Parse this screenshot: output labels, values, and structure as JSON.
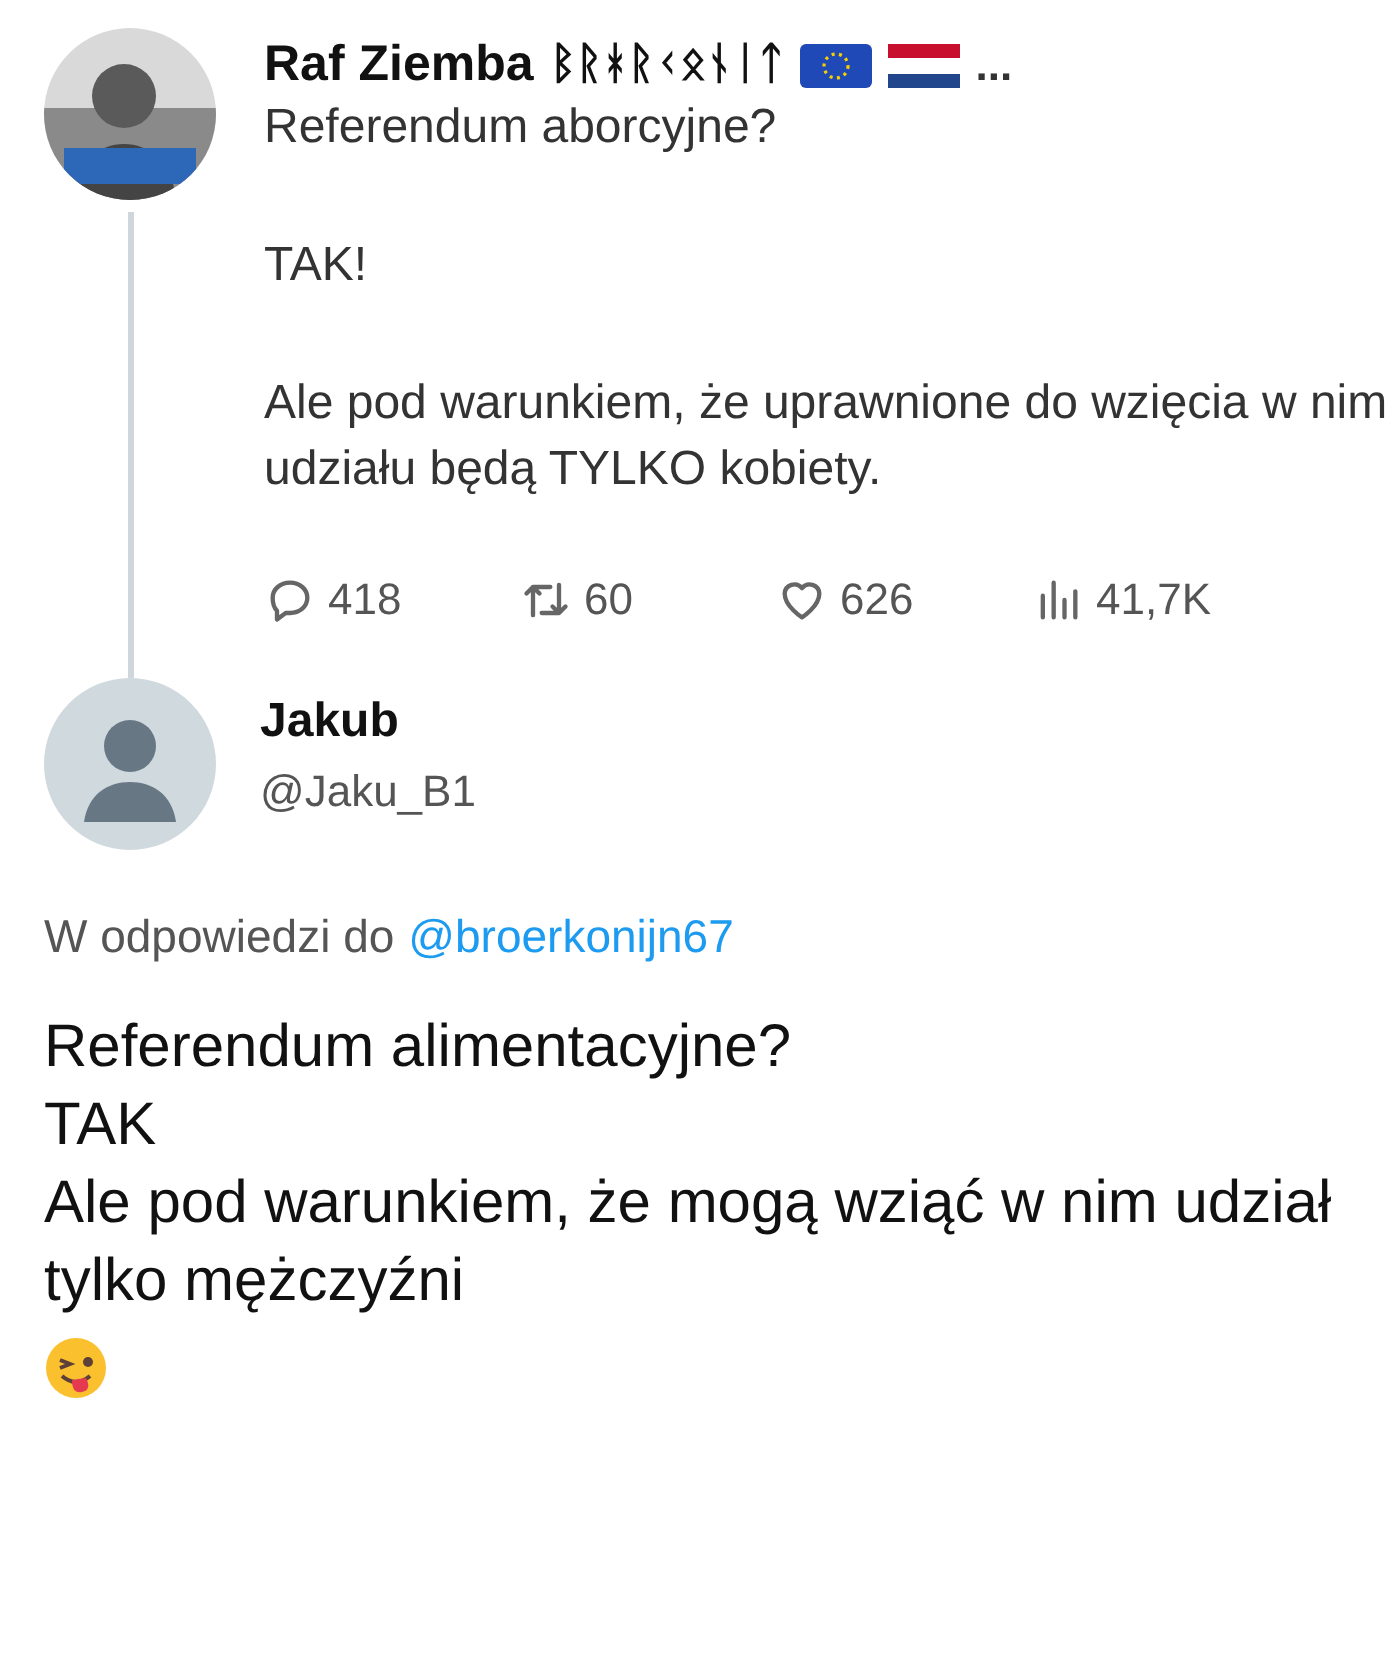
{
  "original_tweet": {
    "author": {
      "name": "Raf Ziemba",
      "runes": "ᛒᚱᚼᚱᚲᛟᚾᛁᛏ",
      "ellipsis": "..."
    },
    "paragraphs": [
      "Referendum aborcyjne?",
      "TAK!",
      "Ale pod warunkiem, że uprawnione do wzięcia w nim udziału będą TYLKO kobiety."
    ],
    "stats": [
      {
        "kind": "reply",
        "count": "418"
      },
      {
        "kind": "retweet",
        "count": "60"
      },
      {
        "kind": "like",
        "count": "626"
      },
      {
        "kind": "views",
        "count": "41,7K"
      }
    ]
  },
  "reply_tweet": {
    "author": {
      "name": "Jakub",
      "handle": "@Jaku_B1"
    },
    "replying_to": {
      "prefix": "W odpowiedzi do",
      "handle": "@broerkonijn67"
    },
    "lines": [
      "Referendum alimentacyjne?",
      "TAK",
      "Ale pod warunkiem, że mogą wziąć w nim udział tylko mężczyźni"
    ]
  }
}
